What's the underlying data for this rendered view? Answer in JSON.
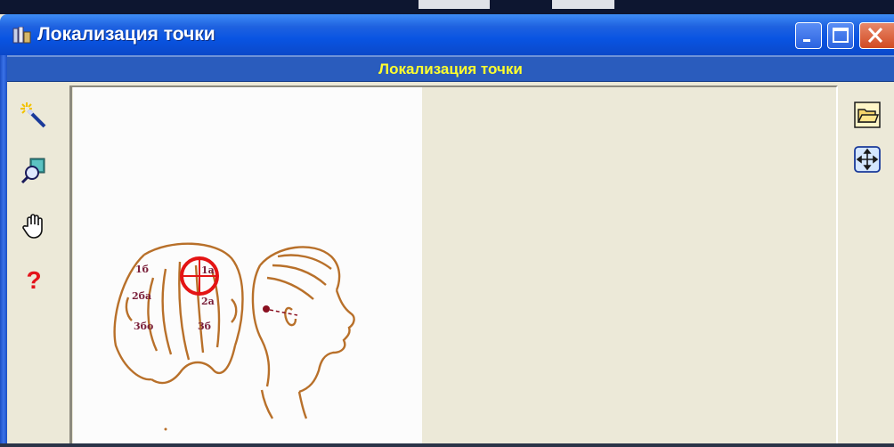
{
  "window": {
    "title": "Локализация точки"
  },
  "header": {
    "caption": "Локализация точки"
  },
  "left_toolbar": {
    "tools": [
      {
        "icon": "magic-wand-icon"
      },
      {
        "icon": "zoom-icon"
      },
      {
        "icon": "hand-pan-icon"
      },
      {
        "icon": "help-icon",
        "glyph": "?"
      }
    ]
  },
  "right_toolbar": {
    "tools": [
      {
        "icon": "open-folder-icon"
      },
      {
        "icon": "fit-to-window-icon"
      }
    ]
  },
  "image": {
    "left_head_labels": [
      "1б",
      "1а",
      "2ба",
      "2а",
      "3бо",
      "3б"
    ]
  },
  "colors": {
    "title_gradient": "#0954e2",
    "caption_bg": "#2a5cbd",
    "caption_text": "#ffff2e",
    "panel_bg": "#ece9d8",
    "drawing": "#b8702a",
    "marker": "#e41414",
    "point": "#8a1020"
  }
}
